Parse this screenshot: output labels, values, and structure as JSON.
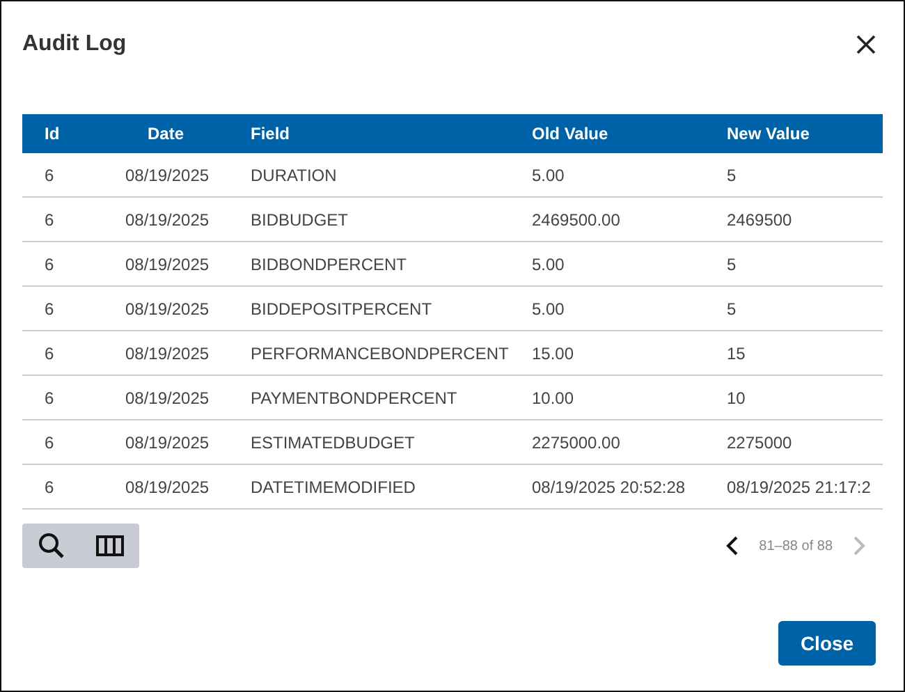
{
  "dialog": {
    "title": "Audit Log"
  },
  "table": {
    "columns": [
      "Id",
      "Date",
      "Field",
      "Old Value",
      "New Value"
    ],
    "rows": [
      [
        "6",
        "08/19/2025",
        "DURATION",
        "5.00",
        "5"
      ],
      [
        "6",
        "08/19/2025",
        "BIDBUDGET",
        "2469500.00",
        "2469500"
      ],
      [
        "6",
        "08/19/2025",
        "BIDBONDPERCENT",
        "5.00",
        "5"
      ],
      [
        "6",
        "08/19/2025",
        "BIDDEPOSITPERCENT",
        "5.00",
        "5"
      ],
      [
        "6",
        "08/19/2025",
        "PERFORMANCEBONDPERCENT",
        "15.00",
        "15"
      ],
      [
        "6",
        "08/19/2025",
        "PAYMENTBONDPERCENT",
        "10.00",
        "10"
      ],
      [
        "6",
        "08/19/2025",
        "ESTIMATEDBUDGET",
        "2275000.00",
        "2275000"
      ],
      [
        "6",
        "08/19/2025",
        "DATETIMEMODIFIED",
        "08/19/2025 20:52:28",
        "08/19/2025 21:17:2"
      ]
    ]
  },
  "pagination": {
    "range": "81–88 of 88",
    "prev_disabled": false,
    "next_disabled": true
  },
  "buttons": [
    "Close"
  ]
}
